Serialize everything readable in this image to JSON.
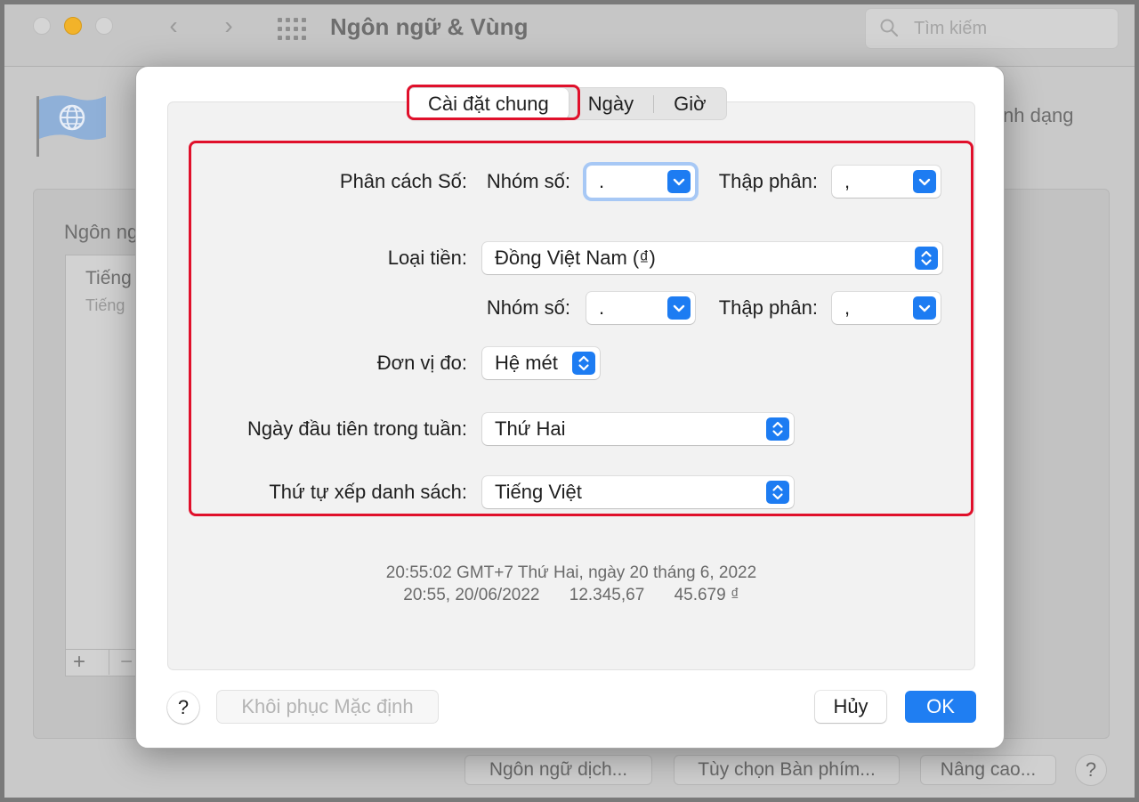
{
  "window": {
    "title": "Ngôn ngữ & Vùng",
    "search_placeholder": "Tìm kiếm",
    "back_glyph": "‹",
    "forward_glyph": "›"
  },
  "background": {
    "right_label": "nh dạng",
    "languages_label": "Ngôn ng",
    "list_item_primary": "Tiếng",
    "list_item_secondary": "Tiếng",
    "add_glyph": "+",
    "remove_glyph": "−",
    "bottom_buttons": [
      "Ngôn ngữ dịch...",
      "Tùy chọn Bàn phím...",
      "Nâng cao..."
    ],
    "help_glyph": "?"
  },
  "tabs": [
    {
      "label": "Cài đặt chung",
      "active": true
    },
    {
      "label": "Ngày",
      "active": false
    },
    {
      "label": "Giờ",
      "active": false
    }
  ],
  "settings": {
    "number_sep_label": "Phân cách Số:",
    "group_label": "Nhóm số:",
    "decimal_label": "Thập phân:",
    "number_group_value": ".",
    "number_decimal_value": ",",
    "currency_label": "Loại tiền:",
    "currency_value": "Đồng Việt Nam (₫)",
    "currency_group_value": ".",
    "currency_decimal_value": ",",
    "measure_label": "Đơn vị đo:",
    "measure_value": "Hệ mét",
    "first_day_label": "Ngày đầu tiên trong tuần:",
    "first_day_value": "Thứ Hai",
    "sort_label": "Thứ tự xếp danh sách:",
    "sort_value": "Tiếng Việt"
  },
  "preview": {
    "line1": "20:55:02 GMT+7 Thứ Hai, ngày 20 tháng 6, 2022",
    "line2_date": "20:55, 20/06/2022",
    "line2_number": "12.345,67",
    "line2_currency": "45.679 ₫"
  },
  "buttons": {
    "help": "?",
    "restore": "Khôi phục Mặc định",
    "cancel": "Hủy",
    "ok": "OK"
  },
  "colors": {
    "accent": "#1f7ef2",
    "highlight_border": "#e0102b"
  }
}
